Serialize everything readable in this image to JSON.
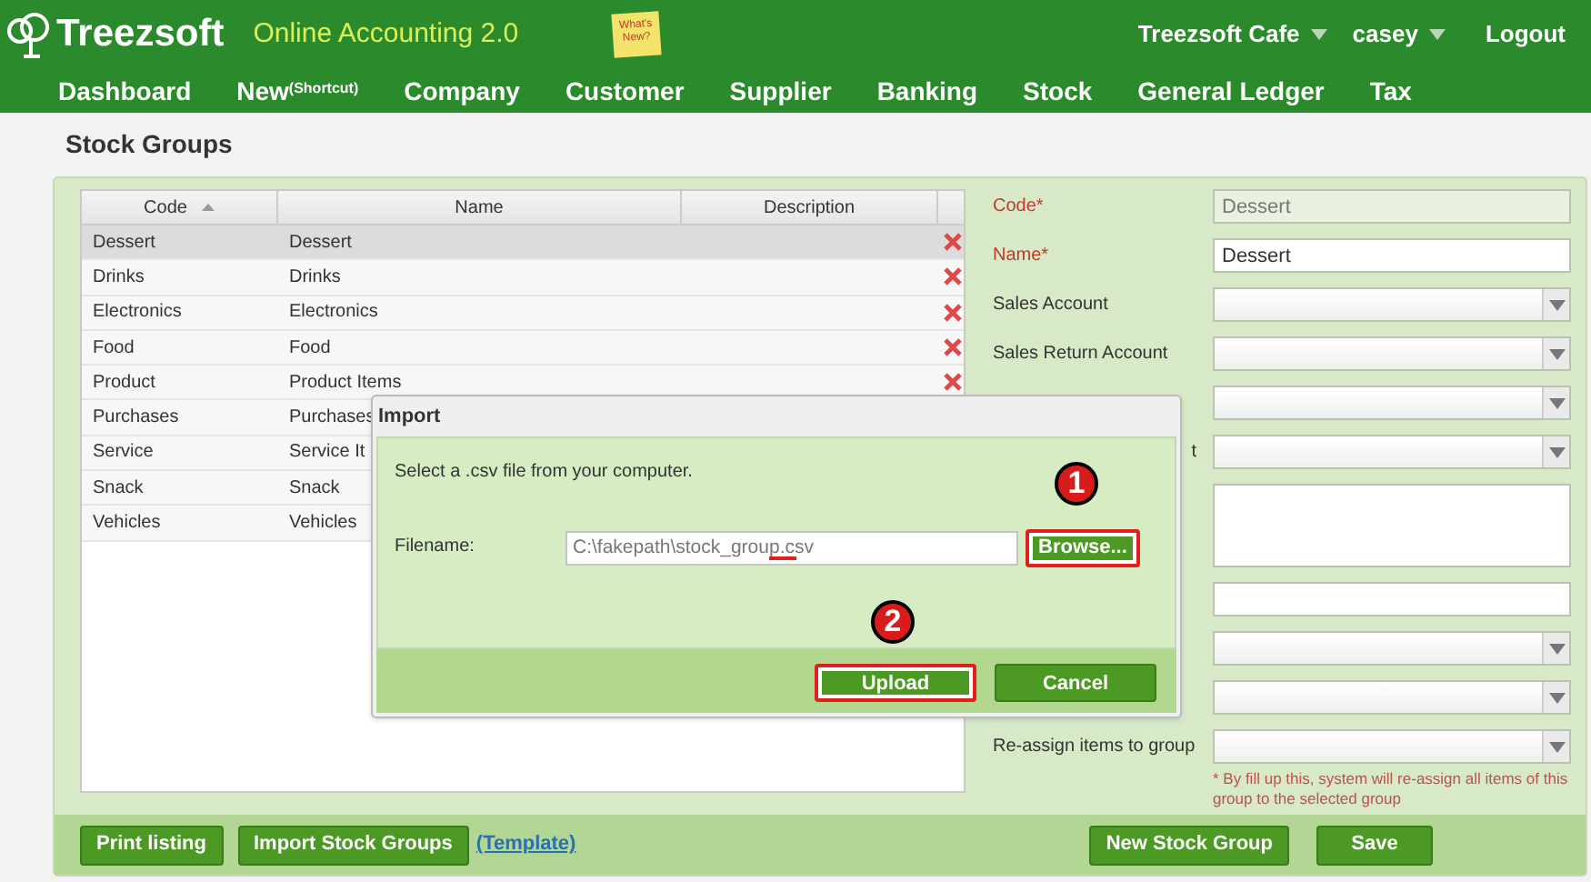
{
  "header": {
    "logo_text": "Treezsoft",
    "app_title": "Online Accounting 2.0",
    "note_text": "What's New?",
    "company": "Treezsoft Cafe",
    "user": "casey",
    "logout": "Logout"
  },
  "nav": [
    "Dashboard",
    "New$^{(Shortcut)}$",
    "Company",
    "Customer",
    "Supplier",
    "Banking",
    "Stock",
    "General Ledger",
    "Tax"
  ],
  "page_title": "Stock Groups",
  "table": {
    "columns": [
      {
        "label": "Code",
        "sorted": true
      },
      {
        "label": "Name",
        "sorted": false
      },
      {
        "label": "Description",
        "sorted": false
      }
    ],
    "rows": [
      {
        "code": "Dessert",
        "name": "Dessert",
        "selected": true,
        "delete_icon": true
      },
      {
        "code": "Drinks",
        "name": "Drinks",
        "selected": false,
        "delete_icon": true
      },
      {
        "code": "Electronics",
        "name": "Electronics",
        "selected": false,
        "delete_icon": true
      },
      {
        "code": "Food",
        "name": "Food",
        "selected": false,
        "delete_icon": true
      },
      {
        "code": "Product",
        "name": "Product Items",
        "selected": false,
        "delete_icon": true
      },
      {
        "code": "Purchases",
        "name": "Purchases",
        "selected": false
      },
      {
        "code": "Service",
        "name": "Service It",
        "selected": false
      },
      {
        "code": "Snack",
        "name": "Snack",
        "selected": false
      },
      {
        "code": "Vehicles",
        "name": "Vehicles",
        "selected": false
      }
    ]
  },
  "form": {
    "fields": [
      {
        "label": "Code*",
        "kind": "text",
        "value": "Dessert",
        "required": true,
        "disabled": true
      },
      {
        "label": "Name*",
        "kind": "text",
        "value": "Dessert",
        "required": true,
        "disabled": false
      },
      {
        "label": "Sales Account",
        "kind": "select",
        "required": false
      },
      {
        "label": "Sales Return Account",
        "kind": "select",
        "required": false
      },
      {
        "kind": "select"
      },
      {
        "label": "t",
        "kind": "select",
        "required": false,
        "label_cut": true
      },
      {
        "kind": "textarea"
      },
      {
        "kind": "text",
        "disabled": false
      },
      {
        "kind": "select"
      },
      {
        "kind": "select"
      },
      {
        "label": "Re-assign items to group",
        "kind": "select",
        "required": false
      }
    ],
    "note": "* By fill up this, system will re-assign all items of this group to the selected group"
  },
  "bottom_bar": {
    "left_buttons": [
      "Print listing",
      "Import Stock Groups"
    ],
    "template_link": "(Template)",
    "right_buttons": [
      "New Stock Group",
      "Save"
    ]
  },
  "dialog": {
    "title": "Import",
    "message": "Select a .csv file from your computer.",
    "filename_label": "Filename:",
    "filename_value": "C:\\fakepath\\stock_group.csv",
    "buttons": [
      {
        "label": "Browse...",
        "highlighted": true,
        "marker": "1"
      },
      {
        "label": "Upload",
        "highlighted": true,
        "marker": "2"
      },
      {
        "label": "Cancel",
        "highlighted": false
      }
    ]
  }
}
